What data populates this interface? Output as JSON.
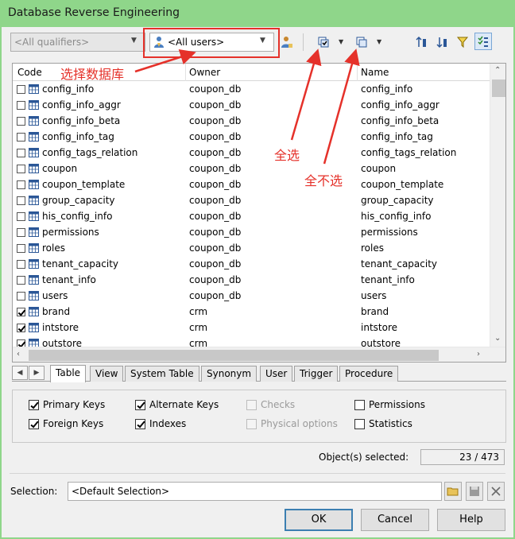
{
  "window": {
    "title": "Database Reverse Engineering"
  },
  "toolbar": {
    "qualifier_value": "<All qualifiers>",
    "owner_value": "<All users>"
  },
  "annotations": {
    "select_database": "选择数据库",
    "select_all": "全选",
    "deselect_all": "全不选"
  },
  "list": {
    "columns": [
      "Code",
      "Owner",
      "Name"
    ],
    "rows": [
      {
        "checked": false,
        "code": "config_info",
        "owner": "coupon_db",
        "name": "config_info"
      },
      {
        "checked": false,
        "code": "config_info_aggr",
        "owner": "coupon_db",
        "name": "config_info_aggr"
      },
      {
        "checked": false,
        "code": "config_info_beta",
        "owner": "coupon_db",
        "name": "config_info_beta"
      },
      {
        "checked": false,
        "code": "config_info_tag",
        "owner": "coupon_db",
        "name": "config_info_tag"
      },
      {
        "checked": false,
        "code": "config_tags_relation",
        "owner": "coupon_db",
        "name": "config_tags_relation"
      },
      {
        "checked": false,
        "code": "coupon",
        "owner": "coupon_db",
        "name": "coupon"
      },
      {
        "checked": false,
        "code": "coupon_template",
        "owner": "coupon_db",
        "name": "coupon_template"
      },
      {
        "checked": false,
        "code": "group_capacity",
        "owner": "coupon_db",
        "name": "group_capacity"
      },
      {
        "checked": false,
        "code": "his_config_info",
        "owner": "coupon_db",
        "name": "his_config_info"
      },
      {
        "checked": false,
        "code": "permissions",
        "owner": "coupon_db",
        "name": "permissions"
      },
      {
        "checked": false,
        "code": "roles",
        "owner": "coupon_db",
        "name": "roles"
      },
      {
        "checked": false,
        "code": "tenant_capacity",
        "owner": "coupon_db",
        "name": "tenant_capacity"
      },
      {
        "checked": false,
        "code": "tenant_info",
        "owner": "coupon_db",
        "name": "tenant_info"
      },
      {
        "checked": false,
        "code": "users",
        "owner": "coupon_db",
        "name": "users"
      },
      {
        "checked": true,
        "code": "brand",
        "owner": "crm",
        "name": "brand"
      },
      {
        "checked": true,
        "code": "intstore",
        "owner": "crm",
        "name": "intstore"
      },
      {
        "checked": true,
        "code": "outstore",
        "owner": "crm",
        "name": "outstore"
      }
    ]
  },
  "tabs": [
    "Table",
    "View",
    "System Table",
    "Synonym",
    "User",
    "Trigger",
    "Procedure"
  ],
  "active_tab": "Table",
  "options": {
    "primary_keys": {
      "label": "Primary Keys",
      "checked": true,
      "enabled": true
    },
    "foreign_keys": {
      "label": "Foreign Keys",
      "checked": true,
      "enabled": true
    },
    "alternate_keys": {
      "label": "Alternate Keys",
      "checked": true,
      "enabled": true
    },
    "indexes": {
      "label": "Indexes",
      "checked": true,
      "enabled": true
    },
    "checks": {
      "label": "Checks",
      "checked": false,
      "enabled": false
    },
    "physical_options": {
      "label": "Physical options",
      "checked": false,
      "enabled": false
    },
    "permissions": {
      "label": "Permissions",
      "checked": false,
      "enabled": true
    },
    "statistics": {
      "label": "Statistics",
      "checked": false,
      "enabled": true
    }
  },
  "status": {
    "label": "Object(s) selected:",
    "value": "23 / 473"
  },
  "selection": {
    "label": "Selection:",
    "value": "<Default Selection>"
  },
  "buttons": {
    "ok": "OK",
    "cancel": "Cancel",
    "help": "Help"
  },
  "colors": {
    "title_bar": "#8fd68a",
    "annotation": "#e5312a",
    "default_button_border": "#3c7fb1"
  }
}
